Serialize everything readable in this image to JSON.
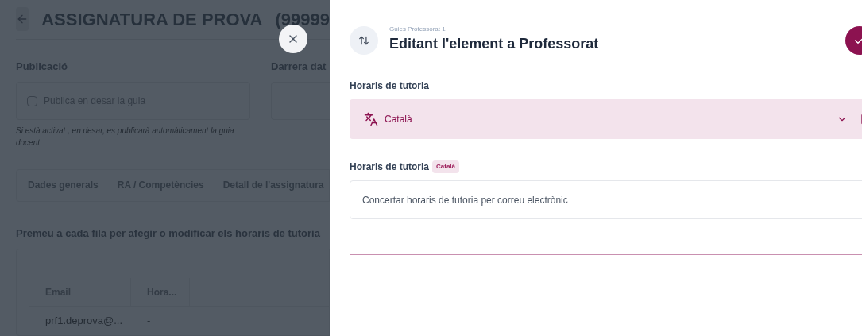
{
  "background": {
    "title": "ASSIGNATURA DE PROVA",
    "code": "(99999",
    "publication": {
      "label": "Publicació",
      "checkbox": {
        "label": "Publica en desar la guia",
        "checked": false
      },
      "help": "Si està activat , en desar, es publicarà automàticament la guia docent"
    },
    "last_date_label": "Darrera dat",
    "tabs": [
      {
        "label": "Dades generals",
        "selected": false
      },
      {
        "label": "RA / Competències",
        "selected": false
      },
      {
        "label": "Detall de l'assignatura",
        "selected": false
      }
    ],
    "instructions": "Premeu a cada fila per afegir o modificar els horaris de tutoria",
    "table": {
      "columns": [
        "Email",
        "Hora..."
      ],
      "rows": [
        [
          "prf1.deprova@...",
          "-"
        ]
      ]
    }
  },
  "panel": {
    "subtitle": "Guies Professorat 1",
    "title": "Editant l'element a Professorat",
    "section_label": "Horaris de tutoria",
    "language": "Català",
    "field": {
      "label": "Horaris de tutoria",
      "badge": "Català",
      "value": "Concertar horaris de tutoria per correu electrònic"
    }
  }
}
